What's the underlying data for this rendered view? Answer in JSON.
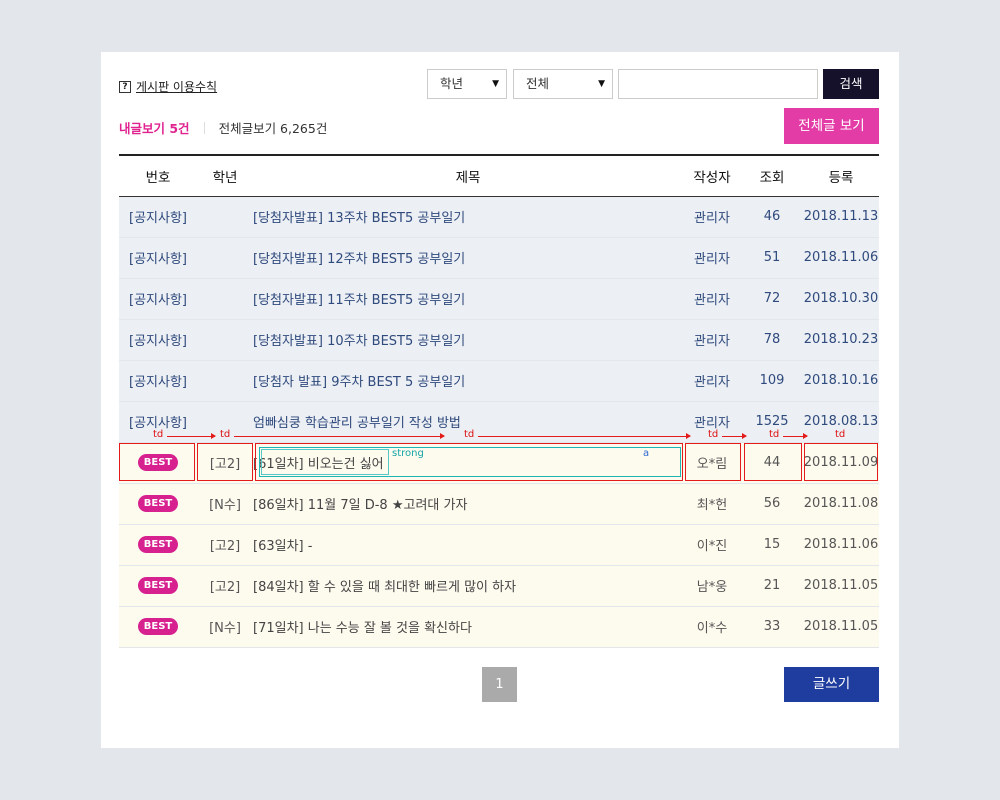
{
  "toolbar": {
    "rules_icon": "?",
    "rules_link": "게시판 이용수칙",
    "grade_select": "학년",
    "scope_select": "전체",
    "search_placeholder": "",
    "search_button": "검색"
  },
  "counts": {
    "my_posts": "내글보기 5건",
    "all_posts": "전체글보기 6,265건",
    "view_all_button": "전체글 보기"
  },
  "table": {
    "headers": [
      "번호",
      "학년",
      "제목",
      "작성자",
      "조회",
      "등록"
    ],
    "notices": [
      {
        "num": "[공지사항]",
        "grade": "",
        "title": "[당첨자발표] 13주차 BEST5 공부일기",
        "author": "관리자",
        "views": "46",
        "date": "2018.11.13"
      },
      {
        "num": "[공지사항]",
        "grade": "",
        "title": "[당첨자발표] 12주차 BEST5 공부일기",
        "author": "관리자",
        "views": "51",
        "date": "2018.11.06"
      },
      {
        "num": "[공지사항]",
        "grade": "",
        "title": "[당첨자발표] 11주차 BEST5 공부일기",
        "author": "관리자",
        "views": "72",
        "date": "2018.10.30"
      },
      {
        "num": "[공지사항]",
        "grade": "",
        "title": "[당첨자발표] 10주차 BEST5 공부일기",
        "author": "관리자",
        "views": "78",
        "date": "2018.10.23"
      },
      {
        "num": "[공지사항]",
        "grade": "",
        "title": "[당첨자 발표] 9주차 BEST 5 공부일기",
        "author": "관리자",
        "views": "109",
        "date": "2018.10.16"
      },
      {
        "num": "[공지사항]",
        "grade": "",
        "title": "엄빠심쿵 학습관리 공부일기 작성 방법",
        "author": "관리자",
        "views": "1525",
        "date": "2018.08.13"
      }
    ],
    "best": [
      {
        "badge": "BEST",
        "grade": "[고2]",
        "title": "[61일차] 비오는건 싫어",
        "author": "오*림",
        "views": "44",
        "date": "2018.11.09"
      },
      {
        "badge": "BEST",
        "grade": "[N수]",
        "title": "[86일차] 11월 7일 D-8 ★고려대 가자",
        "author": "최*헌",
        "views": "56",
        "date": "2018.11.08"
      },
      {
        "badge": "BEST",
        "grade": "[고2]",
        "title": "[63일차] -",
        "author": "이*진",
        "views": "15",
        "date": "2018.11.06"
      },
      {
        "badge": "BEST",
        "grade": "[고2]",
        "title": "[84일차] 할 수 있을 때 최대한 빠르게 많이 하자",
        "author": "남*웅",
        "views": "21",
        "date": "2018.11.05"
      },
      {
        "badge": "BEST",
        "grade": "[N수]",
        "title": "[71일차] 나는 수능 잘 볼 것을 확신하다",
        "author": "이*수",
        "views": "33",
        "date": "2018.11.05"
      }
    ]
  },
  "overlay": {
    "td_label": "td",
    "strong_label": "strong",
    "a_label": "a"
  },
  "pagination": {
    "current": "1"
  },
  "write_button": "글쓰기",
  "colors": {
    "background": "#e3e7ec",
    "pink_accent": "#e43ca7",
    "navy_button": "#15112b",
    "blue_button": "#1f3d9f",
    "notice_row": "#eceff4",
    "best_row": "#fdfaee"
  }
}
